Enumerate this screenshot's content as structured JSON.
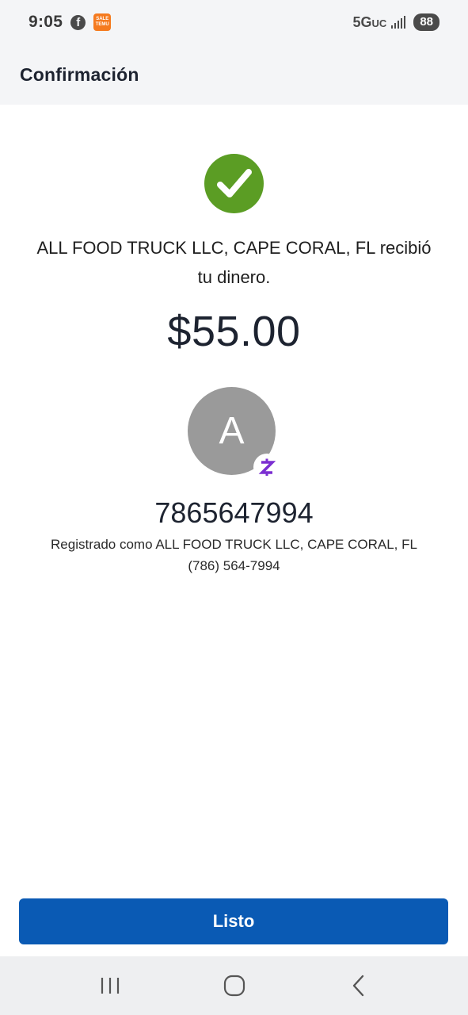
{
  "status_bar": {
    "time": "9:05",
    "app_icon_text_line1": "SALE",
    "app_icon_text_line2": "TEMU",
    "network": "5G",
    "network_suffix": "UC",
    "battery": "88"
  },
  "header": {
    "title": "Confirmación"
  },
  "confirmation": {
    "message_line1": "ALL FOOD TRUCK LLC, CAPE CORAL, FL recibió",
    "message_line2": "tu dinero.",
    "amount": "$55.00",
    "avatar_initial": "A",
    "recipient_id": "7865647994",
    "registered_line": "Registrado como ALL FOOD TRUCK LLC, CAPE CORAL, FL",
    "phone": "(786) 564-7994"
  },
  "actions": {
    "done_label": "Listo"
  },
  "colors": {
    "success_green": "#5b9d24",
    "primary_blue": "#0a5ab4",
    "badge_purple": "#7b2fd1",
    "avatar_gray": "#9a9a9a"
  },
  "icons": {
    "success": "check-circle-icon",
    "badge": "zelle-logo-icon",
    "nav_recents": "recent-apps-icon",
    "nav_home": "home-icon",
    "nav_back": "back-icon"
  }
}
